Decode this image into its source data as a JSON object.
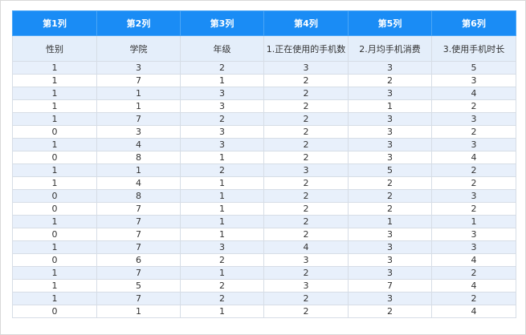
{
  "table": {
    "columns": [
      "第1列",
      "第2列",
      "第3列",
      "第4列",
      "第5列",
      "第6列"
    ],
    "subheaders": [
      "性别",
      "学院",
      "年级",
      "1.正在使用的手机数",
      "2.月均手机消费",
      "3.使用手机时长"
    ],
    "rows": [
      [
        "1",
        "3",
        "2",
        "3",
        "3",
        "5"
      ],
      [
        "1",
        "7",
        "1",
        "2",
        "2",
        "3"
      ],
      [
        "1",
        "1",
        "3",
        "2",
        "3",
        "4"
      ],
      [
        "1",
        "1",
        "3",
        "2",
        "1",
        "2"
      ],
      [
        "1",
        "7",
        "2",
        "2",
        "3",
        "3"
      ],
      [
        "0",
        "3",
        "3",
        "2",
        "3",
        "2"
      ],
      [
        "1",
        "4",
        "3",
        "2",
        "3",
        "3"
      ],
      [
        "0",
        "8",
        "1",
        "2",
        "3",
        "4"
      ],
      [
        "1",
        "1",
        "2",
        "3",
        "5",
        "2"
      ],
      [
        "1",
        "4",
        "1",
        "2",
        "2",
        "2"
      ],
      [
        "0",
        "8",
        "1",
        "2",
        "2",
        "3"
      ],
      [
        "0",
        "7",
        "1",
        "2",
        "2",
        "2"
      ],
      [
        "1",
        "7",
        "1",
        "2",
        "1",
        "1"
      ],
      [
        "0",
        "7",
        "1",
        "2",
        "3",
        "3"
      ],
      [
        "1",
        "7",
        "3",
        "4",
        "3",
        "3"
      ],
      [
        "0",
        "6",
        "2",
        "3",
        "3",
        "4"
      ],
      [
        "1",
        "7",
        "1",
        "2",
        "3",
        "2"
      ],
      [
        "1",
        "5",
        "2",
        "3",
        "7",
        "4"
      ],
      [
        "1",
        "7",
        "2",
        "2",
        "3",
        "2"
      ],
      [
        "0",
        "1",
        "1",
        "2",
        "2",
        "4"
      ]
    ]
  },
  "colors": {
    "header_bg": "#1a8cf5",
    "subheader_bg": "#e4eefa",
    "stripe_bg": "#e8f0fb"
  }
}
